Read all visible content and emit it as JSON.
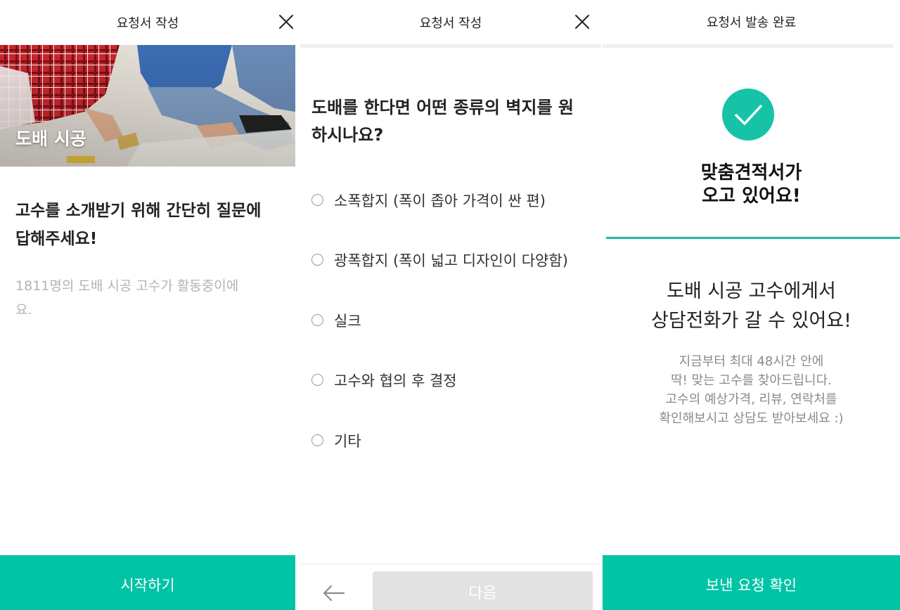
{
  "screen1": {
    "header_title": "요청서 작성",
    "hero_label": "도배 시공",
    "heading_line1": "고수를 소개받기 위해 간단히 질문에",
    "heading_line2": "답해주세요!",
    "sub_line1": "1811명의 도배 시공 고수가 활동중이에",
    "sub_line2": "요.",
    "start_button": "시작하기",
    "icons": {
      "close": "close-icon"
    }
  },
  "screen2": {
    "header_title": "요청서 작성",
    "question_line1": "도배를 한다면 어떤 종류의 벽지를 원",
    "question_line2": "하시나요?",
    "options": [
      "소폭합지 (폭이 좁아 가격이 싼 편)",
      "광폭합지 (폭이 넓고 디자인이 다양함)",
      "실크",
      "고수와 협의 후 결정",
      "기타"
    ],
    "next_button": "다음",
    "icons": {
      "close": "close-icon",
      "back": "arrow-left-icon"
    }
  },
  "screen3": {
    "header_title": "요청서 발송 완료",
    "heading_line1": "맞춤견적서가",
    "heading_line2": "오고 있어요!",
    "message_line1": "도배 시공 고수에게서",
    "message_line2": "상담전화가 갈 수 있어요!",
    "info_lines": [
      "지금부터 최대 48시간 안에",
      "딱! 맞는 고수를 찾아드립니다.",
      "고수의 예상가격, 리뷰, 연락처를",
      "확인해보시고 상담도 받아보세요 :)"
    ],
    "confirm_button": "보낸 요청 확인",
    "icons": {
      "check": "check-icon"
    }
  },
  "colors": {
    "accent": "#00c4a6",
    "check_circle": "#17c3a6",
    "disabled_button": "#e2e2e2",
    "sub_text": "#b3b3b3"
  }
}
